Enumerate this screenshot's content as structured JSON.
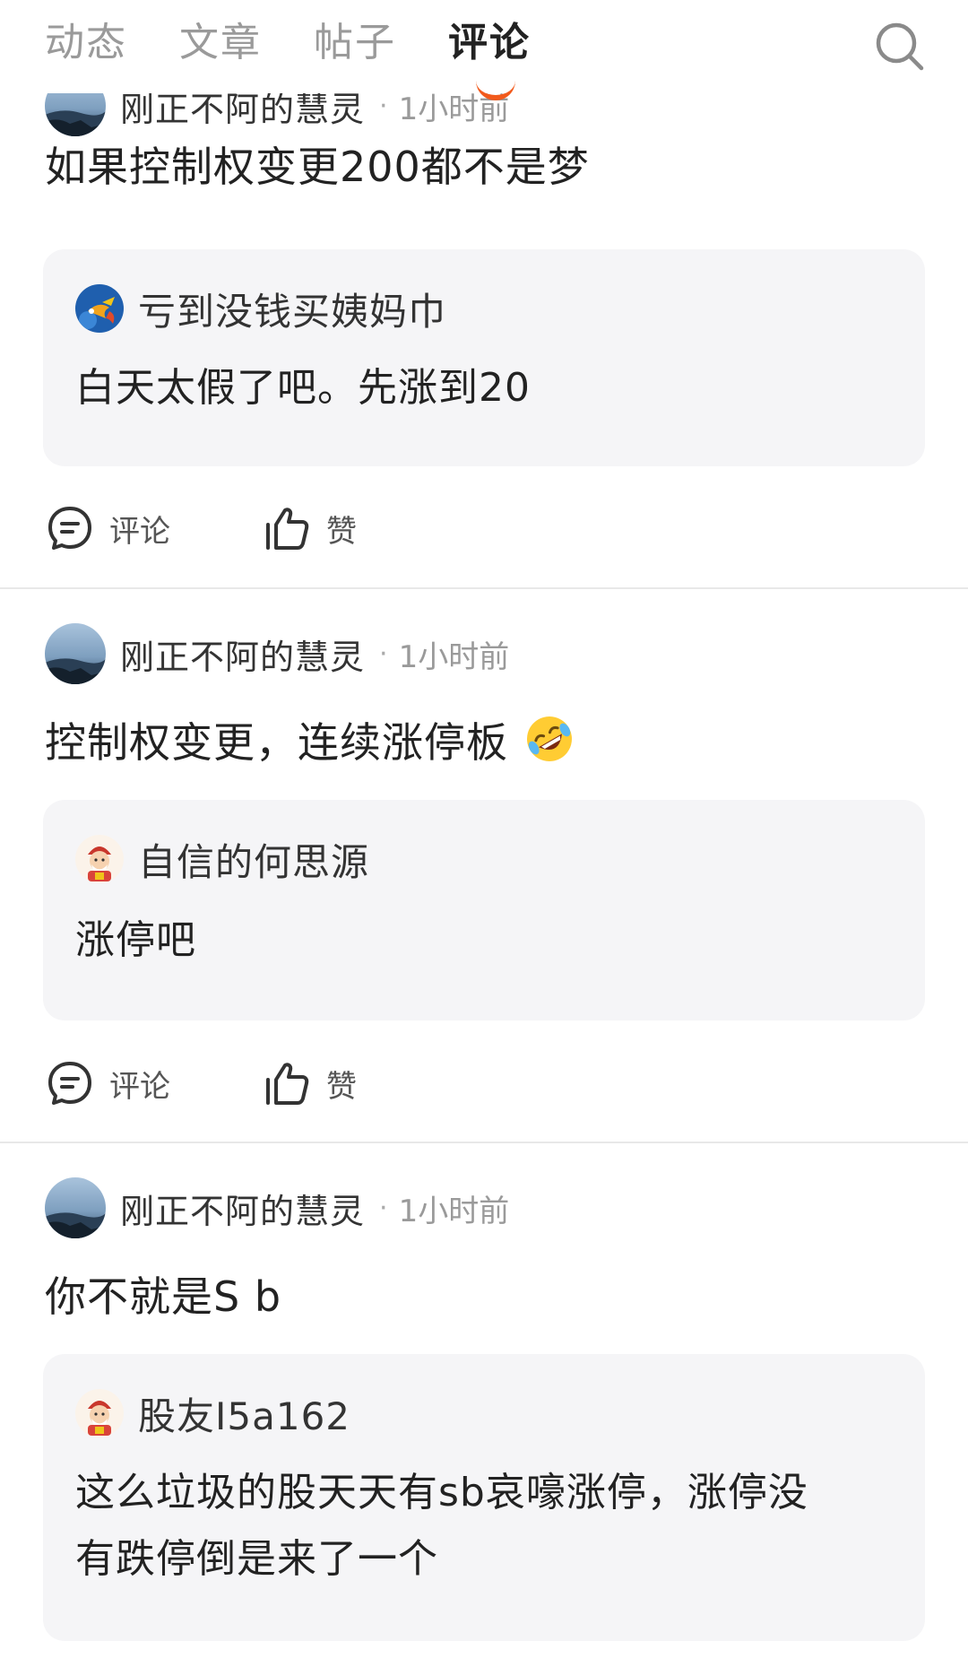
{
  "tabs": [
    {
      "label": "动态",
      "active": false
    },
    {
      "label": "文章",
      "active": false
    },
    {
      "label": "帖子",
      "active": false
    },
    {
      "label": "评论",
      "active": true
    }
  ],
  "search": {
    "icon": "search-icon"
  },
  "colors": {
    "accent": "#f25a1c",
    "quote_bg": "#f5f5f7",
    "divider": "#e8e8e8"
  },
  "posts": [
    {
      "author": "刚正不阿的慧灵",
      "separator": "·",
      "time": "1小时前",
      "body": "如果控制权变更200都不是梦",
      "quote": {
        "author": "亏到没钱买姨妈巾",
        "avatar": "fish-avatar",
        "lines": [
          "白天太假了吧。先涨到20"
        ]
      },
      "actions": {
        "comment": "评论",
        "like": "赞"
      }
    },
    {
      "author": "刚正不阿的慧灵",
      "separator": "·",
      "time": "1小时前",
      "body": "控制权变更，连续涨停板",
      "emoji": "rolling-laughing-emoji",
      "quote": {
        "author": "自信的何思源",
        "avatar": "fortune-god-avatar",
        "lines": [
          "涨停吧"
        ]
      },
      "actions": {
        "comment": "评论",
        "like": "赞"
      }
    },
    {
      "author": "刚正不阿的慧灵",
      "separator": "·",
      "time": "1小时前",
      "body": "你不就是S b",
      "quote": {
        "author": "股友I5a162",
        "avatar": "fortune-god-avatar",
        "lines": [
          "这么垃圾的股天天有sb哀嚎涨停，涨停没",
          "有跌停倒是来了一个"
        ]
      }
    }
  ]
}
